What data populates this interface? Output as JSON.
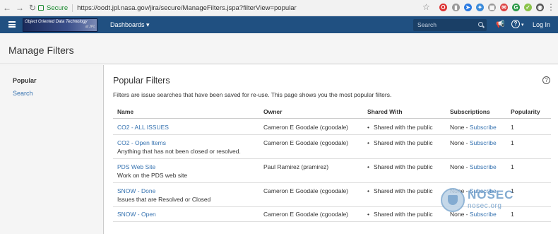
{
  "browser": {
    "secure_label": "Secure",
    "url": "https://oodt.jpl.nasa.gov/jira/secure/ManageFilters.jspa?filterView=popular",
    "menu_glyph": "⋮",
    "star_glyph": "☆"
  },
  "header": {
    "logo_text": "Object Oriented Data Technology",
    "logo_subtext": "at JPL",
    "dashboards_label": "Dashboards ▾",
    "search_placeholder": "Search",
    "help_glyph": "?",
    "login_label": "Log In"
  },
  "page": {
    "title": "Manage Filters"
  },
  "sidebar": {
    "items": [
      {
        "label": "Popular"
      },
      {
        "label": "Search"
      }
    ]
  },
  "main": {
    "heading": "Popular Filters",
    "help_glyph": "?",
    "description": "Filters are issue searches that have been saved for re-use. This page shows you the most popular filters.",
    "columns": [
      "Name",
      "Owner",
      "Shared With",
      "Subscriptions",
      "Popularity"
    ],
    "rows": [
      {
        "name": "CO2 - ALL ISSUES",
        "desc": "",
        "owner": "Cameron E Goodale (cgoodale)",
        "shared": "Shared with the public",
        "subs_prefix": "None - ",
        "subs_link": "Subscribe",
        "popularity": "1"
      },
      {
        "name": "CO2 - Open Items",
        "desc": "Anything that has not been closed or resolved.",
        "owner": "Cameron E Goodale (cgoodale)",
        "shared": "Shared with the public",
        "subs_prefix": "None - ",
        "subs_link": "Subscribe",
        "popularity": "1"
      },
      {
        "name": "PDS Web Site",
        "desc": "Work on the PDS web site",
        "owner": "Paul Ramirez (pramirez)",
        "shared": "Shared with the public",
        "subs_prefix": "None - ",
        "subs_link": "Subscribe",
        "popularity": "1"
      },
      {
        "name": "SNOW - Done",
        "desc": "Issues that are Resolved or Closed",
        "owner": "Cameron E Goodale (cgoodale)",
        "shared": "Shared with the public",
        "subs_prefix": "None - ",
        "subs_link": "Subscribe",
        "popularity": "1"
      },
      {
        "name": "SNOW - Open",
        "desc": "",
        "owner": "Cameron E Goodale (cgoodale)",
        "shared": "Shared with the public",
        "subs_prefix": "None - ",
        "subs_link": "Subscribe",
        "popularity": "1"
      }
    ]
  },
  "watermark": {
    "title": "NOSEC",
    "subtitle": "nosec.org"
  }
}
